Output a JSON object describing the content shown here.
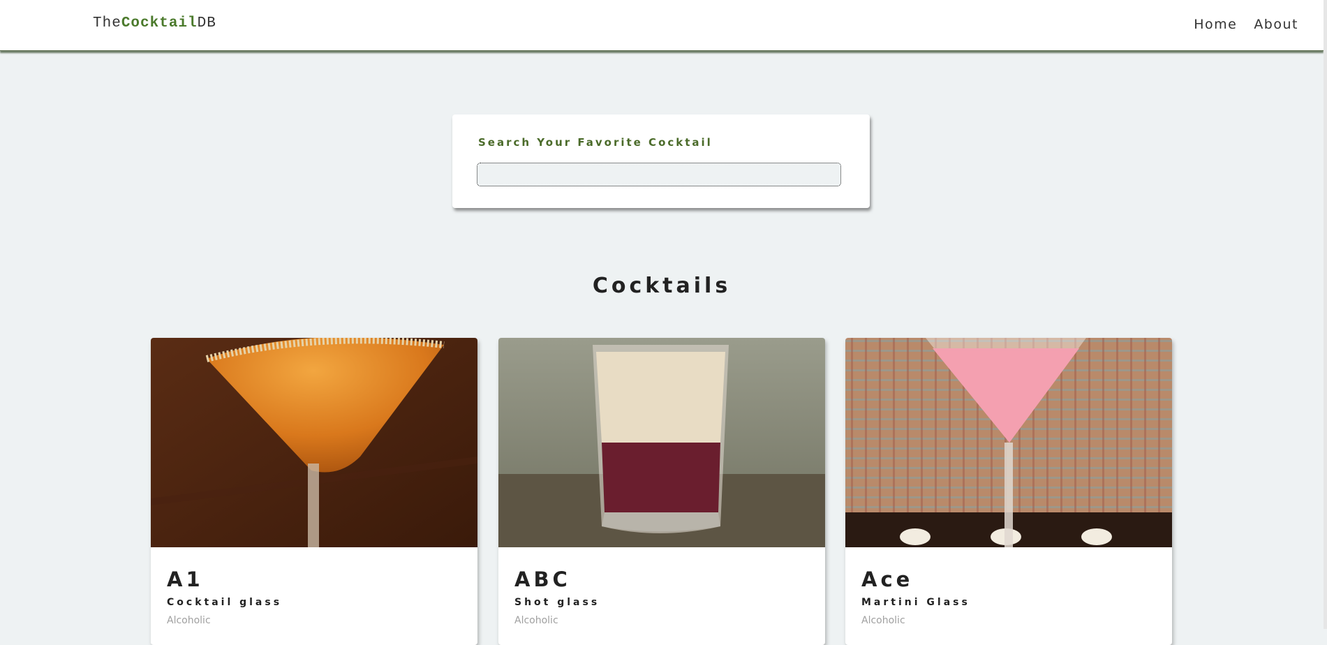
{
  "header": {
    "logo_prefix": "The",
    "logo_brand": "Cocktail",
    "logo_suffix": "DB",
    "nav": [
      "Home",
      "About"
    ]
  },
  "search": {
    "label": "Search Your Favorite Cocktail",
    "value": ""
  },
  "main": {
    "title": "Cocktails",
    "cards": [
      {
        "name": "A1",
        "glass": "Cocktail glass",
        "type": "Alcoholic"
      },
      {
        "name": "ABC",
        "glass": "Shot glass",
        "type": "Alcoholic"
      },
      {
        "name": "Ace",
        "glass": "Martini Glass",
        "type": "Alcoholic"
      }
    ]
  },
  "colors": {
    "accent": "#4b7a2c",
    "background": "#eef2f3"
  }
}
